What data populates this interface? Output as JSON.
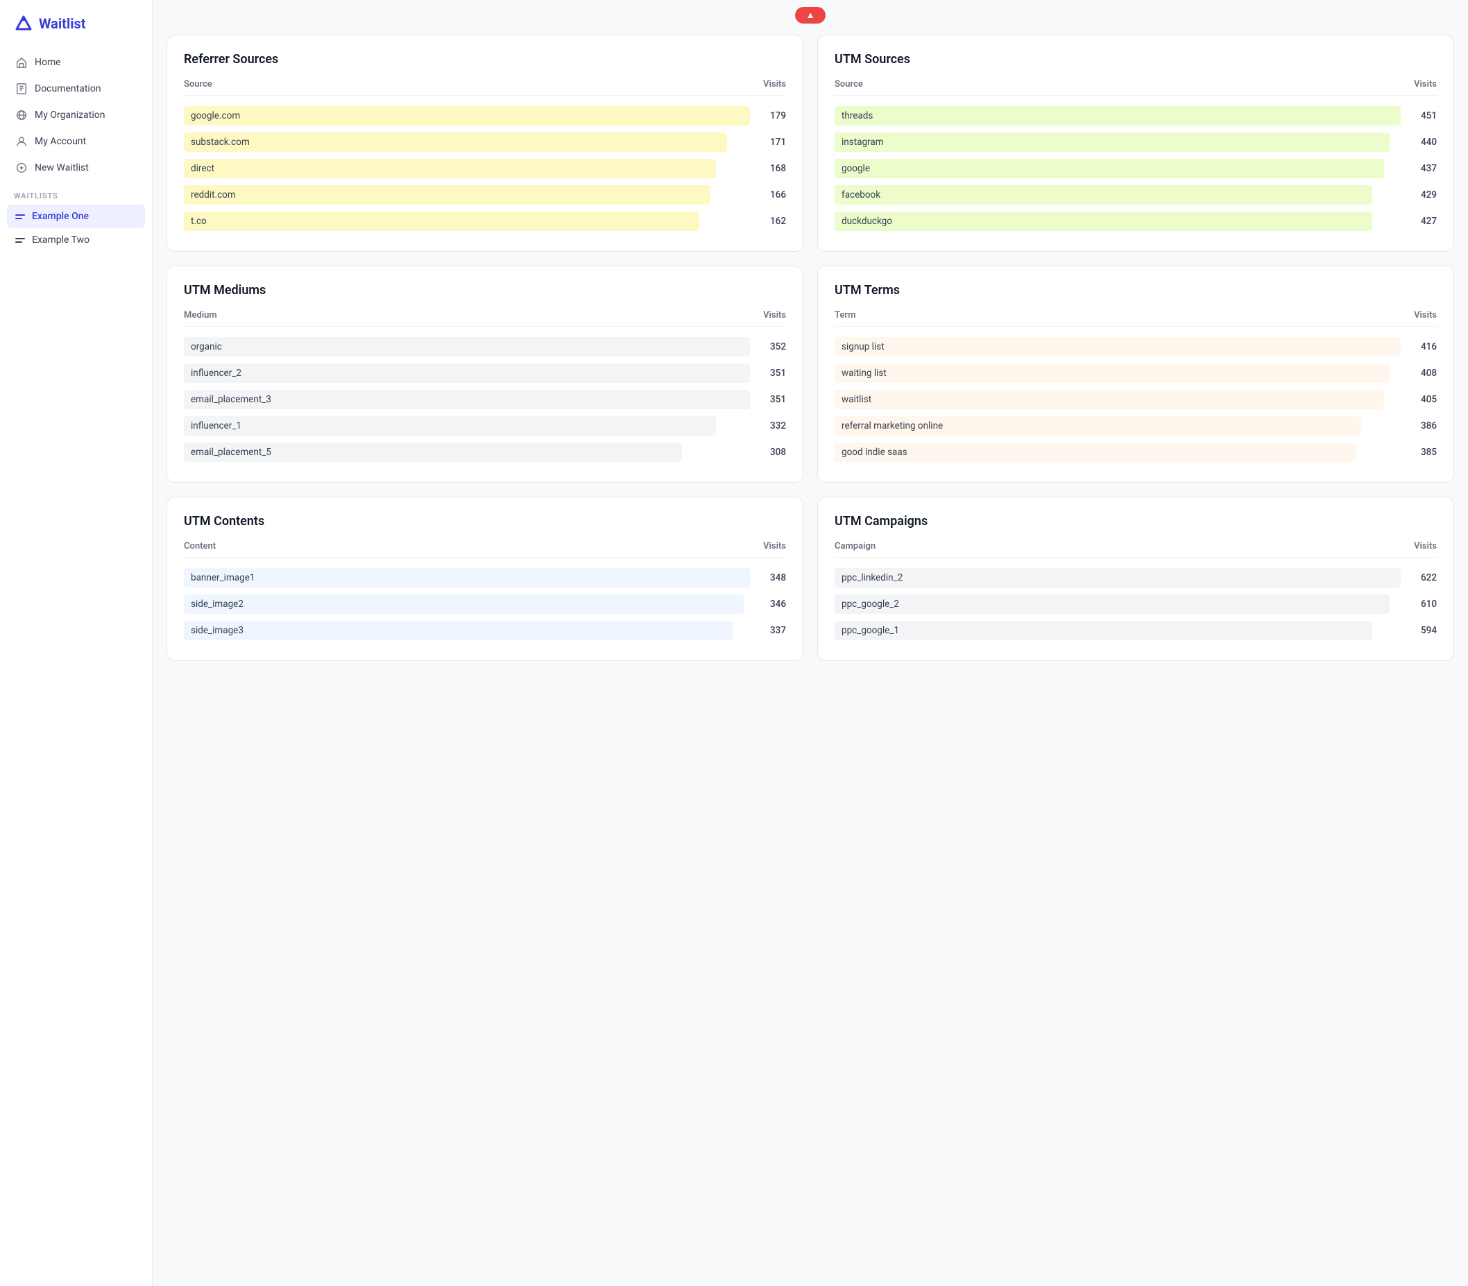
{
  "app": {
    "logo_text": "Waitlist",
    "top_pill": "▲"
  },
  "sidebar": {
    "nav_items": [
      {
        "label": "Home",
        "icon": "home-icon"
      },
      {
        "label": "Documentation",
        "icon": "book-icon"
      },
      {
        "label": "My Organization",
        "icon": "globe-icon"
      },
      {
        "label": "My Account",
        "icon": "user-icon"
      },
      {
        "label": "New Waitlist",
        "icon": "plus-icon"
      }
    ],
    "section_label": "WAITLISTS",
    "waitlists": [
      {
        "label": "Example One",
        "active": true
      },
      {
        "label": "Example Two",
        "active": false
      }
    ]
  },
  "referrer_sources": {
    "title": "Referrer Sources",
    "col_source": "Source",
    "col_visits": "Visits",
    "rows": [
      {
        "source": "google.com",
        "visits": 179,
        "pct": 100
      },
      {
        "source": "substack.com",
        "visits": 171,
        "pct": 96
      },
      {
        "source": "direct",
        "visits": 168,
        "pct": 94
      },
      {
        "source": "reddit.com",
        "visits": 166,
        "pct": 93
      },
      {
        "source": "t.co",
        "visits": 162,
        "pct": 91
      }
    ]
  },
  "utm_sources": {
    "title": "UTM Sources",
    "col_source": "Source",
    "col_visits": "Visits",
    "rows": [
      {
        "source": "threads",
        "visits": 451,
        "pct": 100
      },
      {
        "source": "instagram",
        "visits": 440,
        "pct": 98
      },
      {
        "source": "google",
        "visits": 437,
        "pct": 97
      },
      {
        "source": "facebook",
        "visits": 429,
        "pct": 95
      },
      {
        "source": "duckduckgo",
        "visits": 427,
        "pct": 95
      }
    ]
  },
  "utm_mediums": {
    "title": "UTM Mediums",
    "col_medium": "Medium",
    "col_visits": "Visits",
    "rows": [
      {
        "medium": "organic",
        "visits": 352,
        "pct": 100
      },
      {
        "medium": "influencer_2",
        "visits": 351,
        "pct": 100
      },
      {
        "medium": "email_placement_3",
        "visits": 351,
        "pct": 100
      },
      {
        "medium": "influencer_1",
        "visits": 332,
        "pct": 94
      },
      {
        "medium": "email_placement_5",
        "visits": 308,
        "pct": 88
      }
    ]
  },
  "utm_terms": {
    "title": "UTM Terms",
    "col_term": "Term",
    "col_visits": "Visits",
    "rows": [
      {
        "term": "signup list",
        "visits": 416,
        "pct": 100
      },
      {
        "term": "waiting list",
        "visits": 408,
        "pct": 98
      },
      {
        "term": "waitlist",
        "visits": 405,
        "pct": 97
      },
      {
        "term": "referral marketing online",
        "visits": 386,
        "pct": 93
      },
      {
        "term": "good indie saas",
        "visits": 385,
        "pct": 92
      }
    ]
  },
  "utm_contents": {
    "title": "UTM Contents",
    "col_content": "Content",
    "col_visits": "Visits",
    "rows": [
      {
        "content": "banner_image1",
        "visits": 348,
        "pct": 100
      },
      {
        "content": "side_image2",
        "visits": 346,
        "pct": 99
      },
      {
        "content": "side_image3",
        "visits": 337,
        "pct": 97
      }
    ]
  },
  "utm_campaigns": {
    "title": "UTM Campaigns",
    "col_campaign": "Campaign",
    "col_visits": "Visits",
    "rows": [
      {
        "campaign": "ppc_linkedin_2",
        "visits": 622,
        "pct": 100
      },
      {
        "campaign": "ppc_google_2",
        "visits": 610,
        "pct": 98
      },
      {
        "campaign": "ppc_google_1",
        "visits": 594,
        "pct": 95
      }
    ]
  }
}
